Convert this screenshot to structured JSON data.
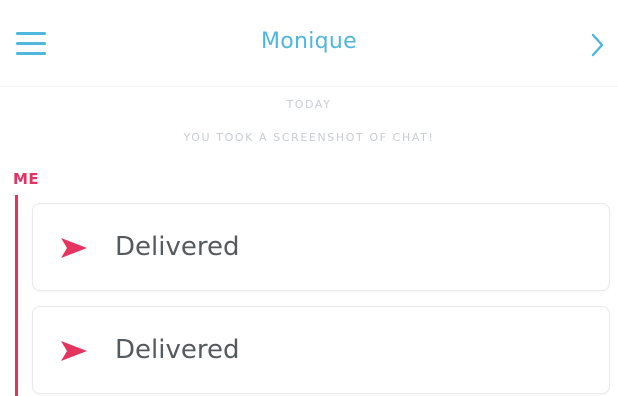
{
  "header": {
    "title": "Monique",
    "menu_icon": "hamburger-menu-icon",
    "next_icon": "chevron-right-icon"
  },
  "notices": {
    "day": "TODAY",
    "screenshot": "YOU TOOK A SCREENSHOT OF CHAT!"
  },
  "thread": {
    "sender": "ME",
    "messages": [
      {
        "status": "Delivered",
        "icon": "sent-arrow-icon"
      },
      {
        "status": "Delivered",
        "icon": "sent-arrow-icon"
      }
    ]
  },
  "colors": {
    "accent_blue": "#4fb6dc",
    "accent_red": "#e5335f",
    "notice_gray": "#c7cdd2",
    "text_dark": "#555a5e"
  }
}
